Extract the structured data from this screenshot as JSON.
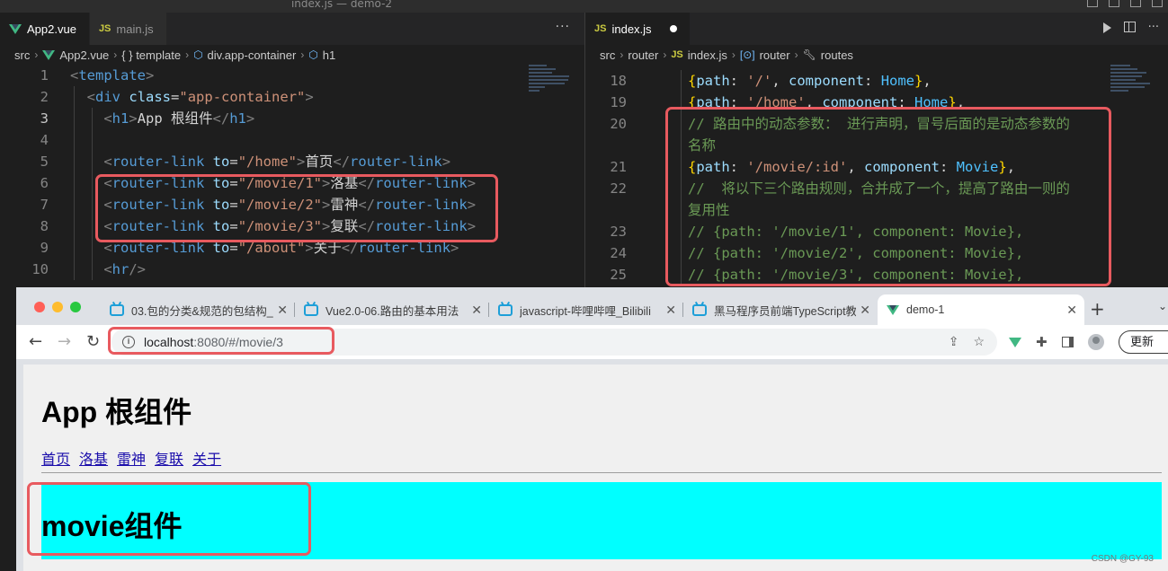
{
  "window": {
    "title": "index.js — demo-2"
  },
  "left_editor": {
    "tabs": [
      {
        "label": "App2.vue",
        "icon": "vue-icon",
        "active": true
      },
      {
        "label": "main.js",
        "icon": "js-icon",
        "active": false
      }
    ],
    "breadcrumb": [
      "src",
      "App2.vue",
      "{ } template",
      "div.app-container",
      "h1"
    ],
    "lines": [
      {
        "n": "1",
        "code": "<template>"
      },
      {
        "n": "2",
        "code": "  <div class=\"app-container\">"
      },
      {
        "n": "3",
        "code": "    <h1>App 根组件</h1>"
      },
      {
        "n": "4",
        "code": ""
      },
      {
        "n": "5",
        "code": "    <router-link to=\"/home\">首页</router-link>"
      },
      {
        "n": "6",
        "code": "    <router-link to=\"/movie/1\">洛基</router-link>"
      },
      {
        "n": "7",
        "code": "    <router-link to=\"/movie/2\">雷神</router-link>"
      },
      {
        "n": "8",
        "code": "    <router-link to=\"/movie/3\">复联</router-link>"
      },
      {
        "n": "9",
        "code": "    <router-link to=\"/about\">关于</router-link>"
      },
      {
        "n": "10",
        "code": "    <hr/>"
      }
    ]
  },
  "right_editor": {
    "tabs": [
      {
        "label": "index.js",
        "icon": "js-icon",
        "active": true,
        "modified": true
      }
    ],
    "breadcrumb": [
      "src",
      "router",
      "index.js",
      "router",
      "routes"
    ],
    "lines": [
      {
        "n": "18",
        "code": "{path: '/', component: Home},"
      },
      {
        "n": "19",
        "code": "{path: '/home', component: Home},"
      },
      {
        "n": "20",
        "code": "// 路由中的动态参数： 进行声明，冒号后面的是动态参数的"
      },
      {
        "n": "",
        "code": "名称"
      },
      {
        "n": "21",
        "code": "{path: '/movie/:id', component: Movie},"
      },
      {
        "n": "22",
        "code": "//  将以下三个路由规则，合并成了一个，提高了路由一则的"
      },
      {
        "n": "",
        "code": "复用性"
      },
      {
        "n": "23",
        "code": "// {path: '/movie/1', component: Movie},"
      },
      {
        "n": "24",
        "code": "// {path: '/movie/2', component: Movie},"
      },
      {
        "n": "25",
        "code": "// {path: '/movie/3', component: Movie},"
      }
    ]
  },
  "browser": {
    "tabs": [
      {
        "label": "03.包的分类&规范的包结构_",
        "icon": "bilibili-icon"
      },
      {
        "label": "Vue2.0-06.路由的基本用法",
        "icon": "bilibili-icon"
      },
      {
        "label": "javascript-哔哩哔哩_Bilibili",
        "icon": "bilibili-icon"
      },
      {
        "label": "黑马程序员前端TypeScript教",
        "icon": "bilibili-icon"
      },
      {
        "label": "demo-1",
        "icon": "vue-icon",
        "active": true
      }
    ],
    "url_host": "localhost",
    "url_rest": ":8080/#/movie/3",
    "update_label": "更新",
    "page": {
      "title": "App 根组件",
      "links": [
        "首页",
        "洛基",
        "雷神",
        "复联",
        "关于"
      ],
      "movie_title": "movie组件"
    }
  },
  "watermark": "CSDN @GY-93",
  "colors": {
    "highlight": "#e85a5f",
    "movie_bg": "#00ffff",
    "vue_green": "#41b883"
  }
}
